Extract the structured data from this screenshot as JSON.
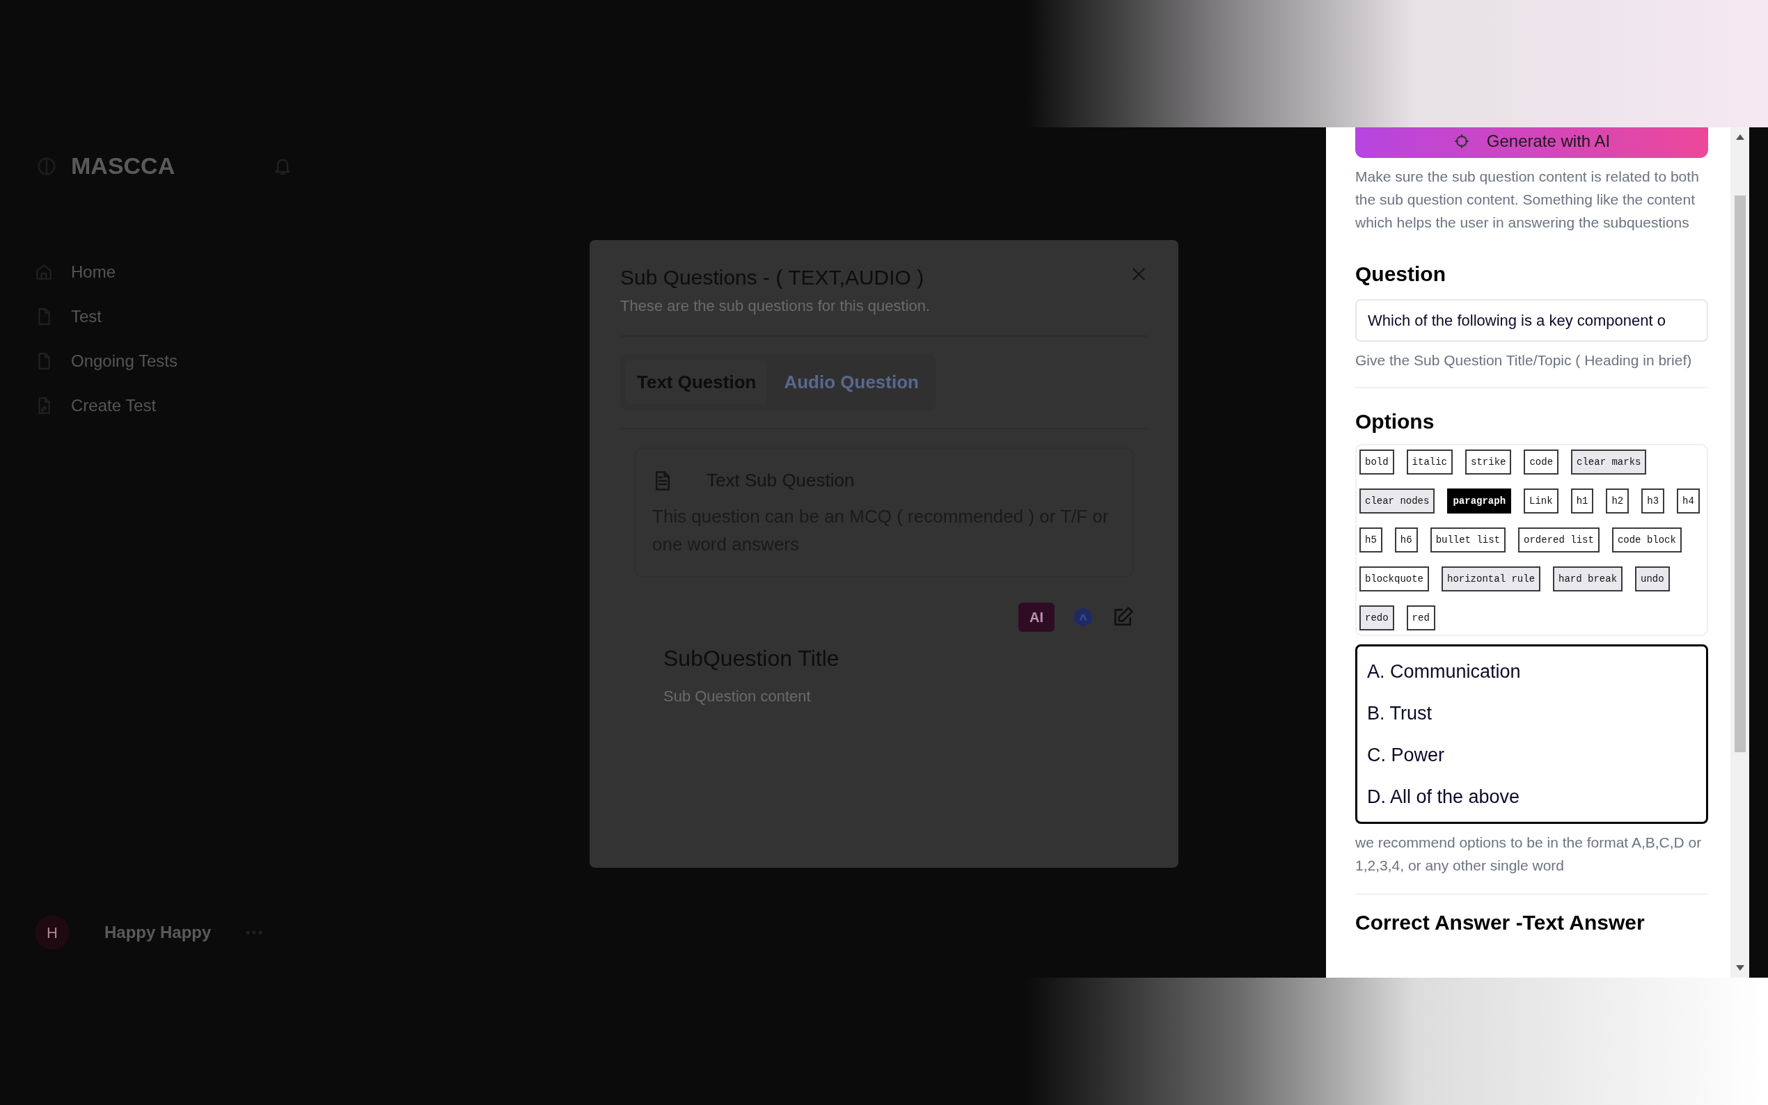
{
  "sidebar": {
    "logo": "MASCCA",
    "items": [
      {
        "label": "Home",
        "selected": false
      },
      {
        "label": "Test",
        "selected": false
      },
      {
        "label": "Ongoing Tests",
        "selected": false
      },
      {
        "label": "Create Test",
        "selected": false
      }
    ],
    "user": {
      "initial": "H",
      "name": "Happy Happy"
    }
  },
  "modal": {
    "title": "Sub Questions - ( TEXT,AUDIO )",
    "subtitle": "These are the sub questions for this question.",
    "tabs": [
      {
        "label": "Text Question",
        "selected": true
      },
      {
        "label": "Audio Question",
        "selected": false
      }
    ],
    "card": {
      "title": "Text Sub Question",
      "description": "This question can be an MCQ ( recommended ) or T/F or one word answers"
    },
    "ai_badge": "AI",
    "subquestion": {
      "title": "SubQuestion Title",
      "content": "Sub Question content"
    }
  },
  "editor_panel": {
    "generate_button": "Generate with AI",
    "ai_hint": "Make sure the sub question content is related to both the sub question content. Something like the content which helps the user in answering the subquestions",
    "question_heading": "Question",
    "question_value": "Which of the following is a key component o",
    "question_hint": "Give the Sub Question Title/Topic ( Heading in brief)",
    "options_heading": "Options",
    "toolbar": [
      {
        "label": "bold",
        "active": false,
        "shaded": false
      },
      {
        "label": "italic",
        "active": false,
        "shaded": false
      },
      {
        "label": "strike",
        "active": false,
        "shaded": false
      },
      {
        "label": "code",
        "active": false,
        "shaded": false
      },
      {
        "label": "clear marks",
        "active": false,
        "shaded": true
      },
      {
        "label": "clear nodes",
        "active": false,
        "shaded": true
      },
      {
        "label": "paragraph",
        "active": true,
        "shaded": false
      },
      {
        "label": "Link",
        "active": false,
        "shaded": false
      },
      {
        "label": "h1",
        "active": false,
        "shaded": false
      },
      {
        "label": "h2",
        "active": false,
        "shaded": false
      },
      {
        "label": "h3",
        "active": false,
        "shaded": false
      },
      {
        "label": "h4",
        "active": false,
        "shaded": false
      },
      {
        "label": "h5",
        "active": false,
        "shaded": false
      },
      {
        "label": "h6",
        "active": false,
        "shaded": false
      },
      {
        "label": "bullet list",
        "active": false,
        "shaded": false
      },
      {
        "label": "ordered list",
        "active": false,
        "shaded": false
      },
      {
        "label": "code block",
        "active": false,
        "shaded": false
      },
      {
        "label": "blockquote",
        "active": false,
        "shaded": false
      },
      {
        "label": "horizontal rule",
        "active": false,
        "shaded": true
      },
      {
        "label": "hard break",
        "active": false,
        "shaded": true
      },
      {
        "label": "undo",
        "active": false,
        "shaded": true
      },
      {
        "label": "redo",
        "active": false,
        "shaded": true
      },
      {
        "label": "red",
        "active": false,
        "shaded": false
      }
    ],
    "options_lines": [
      "A. Communication",
      "B. Trust",
      "C. Power",
      "D. All of the above"
    ],
    "options_hint": "we recommend options to be in the format A,B,C,D or 1,2,3,4, or any other single word",
    "answer_heading": "Correct Answer -Text Answer"
  }
}
